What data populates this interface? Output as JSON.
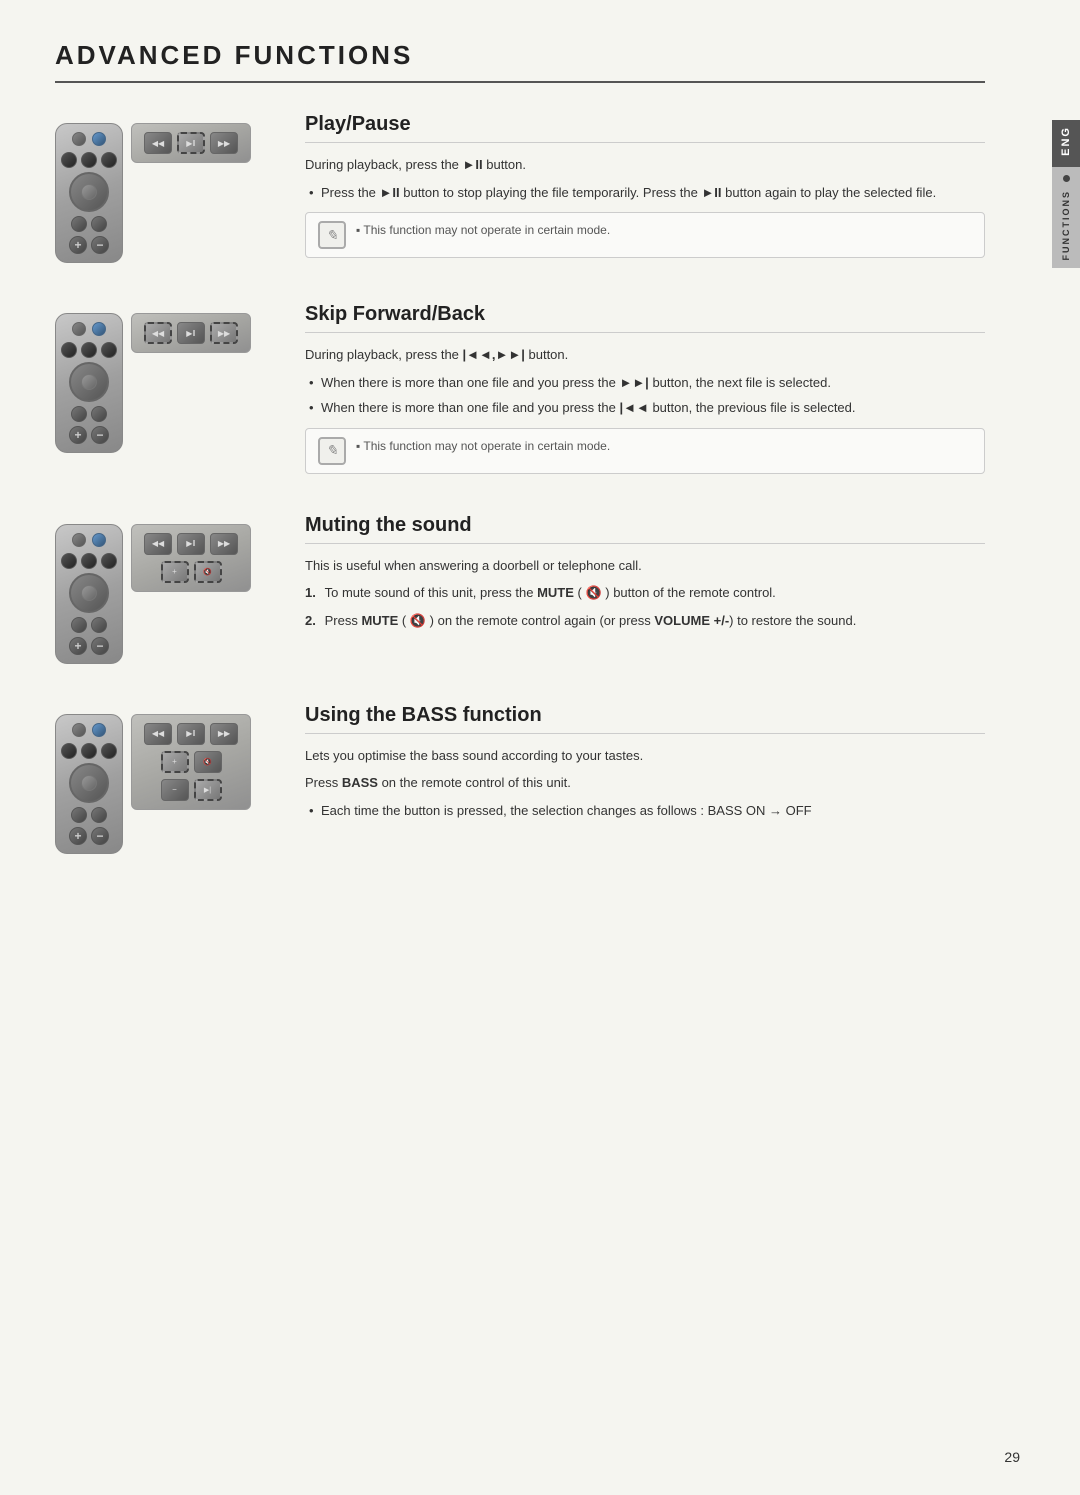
{
  "page": {
    "title": "ADVANCED FUNCTIONS",
    "page_number": "29",
    "side_tab_eng": "ENG",
    "side_tab_functions": "FUNCTIONS"
  },
  "sections": [
    {
      "id": "play-pause",
      "heading": "Play/Pause",
      "intro": "During playback, press the ►II button.",
      "bullets": [
        "Press the ►II button to stop playing the file temporarily. Press the ►II button again to play the selected file."
      ],
      "note": "This function may not operate in certain mode.",
      "has_numbered": false
    },
    {
      "id": "skip-forward-back",
      "heading": "Skip Forward/Back",
      "intro": "During playback, press the |◄◄,►►| button.",
      "bullets": [
        "When there is more than one file and you press the ►►| button, the next file is selected.",
        "When there is more than one file and you press the |◄◄ button, the previous file is selected."
      ],
      "note": "This function may not operate in certain mode.",
      "has_numbered": false
    },
    {
      "id": "muting-sound",
      "heading": "Muting the sound",
      "intro": "This is useful when answering a doorbell or telephone call.",
      "numbered": [
        "To mute sound of this unit, press the MUTE ( 🔇 ) button of the remote control.",
        "Press MUTE ( 🔇 ) on the remote control again (or press VOLUME +/-) to restore the sound."
      ],
      "note": null,
      "has_numbered": true
    },
    {
      "id": "bass-function",
      "heading": "Using the BASS function",
      "intro": "Lets you optimise the bass sound according to your tastes.",
      "intro2": "Press BASS on the remote control of this unit.",
      "bullets": [
        "Each time the button is pressed, the selection changes as follows : BASS ON → OFF"
      ],
      "note": null,
      "has_numbered": false
    }
  ]
}
